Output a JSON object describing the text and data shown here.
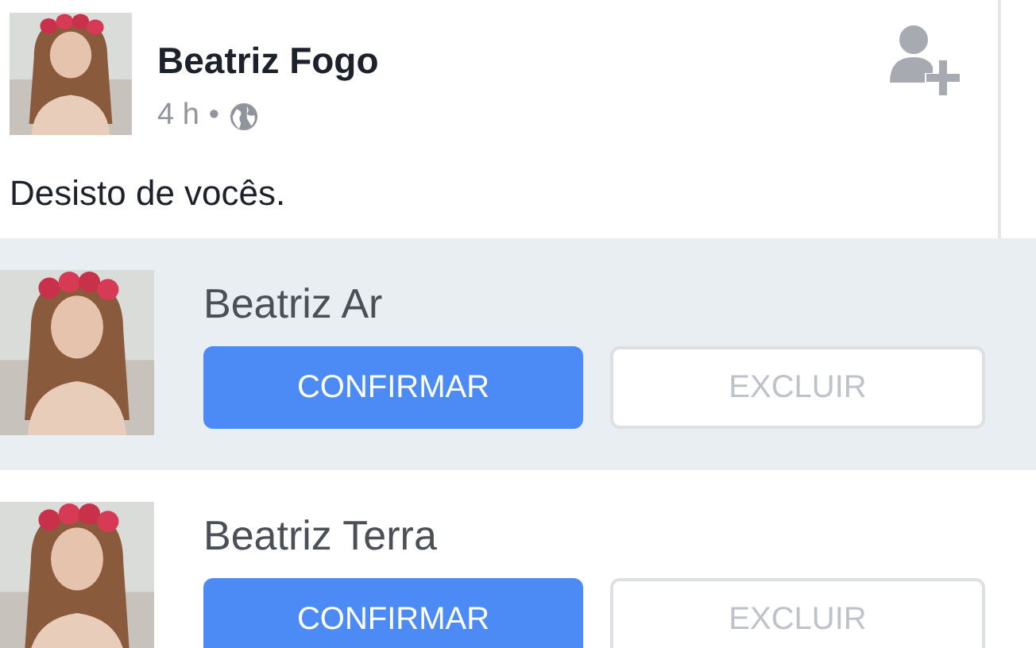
{
  "post": {
    "author": "Beatriz Fogo",
    "time": "4 h",
    "separator": "•",
    "text": "Desisto de vocês."
  },
  "requests": [
    {
      "name": "Beatriz Ar",
      "highlighted": true,
      "confirm": "CONFIRMAR",
      "delete": "EXCLUIR"
    },
    {
      "name": "Beatriz Terra",
      "highlighted": false,
      "confirm": "CONFIRMAR",
      "delete": "EXCLUIR"
    }
  ]
}
